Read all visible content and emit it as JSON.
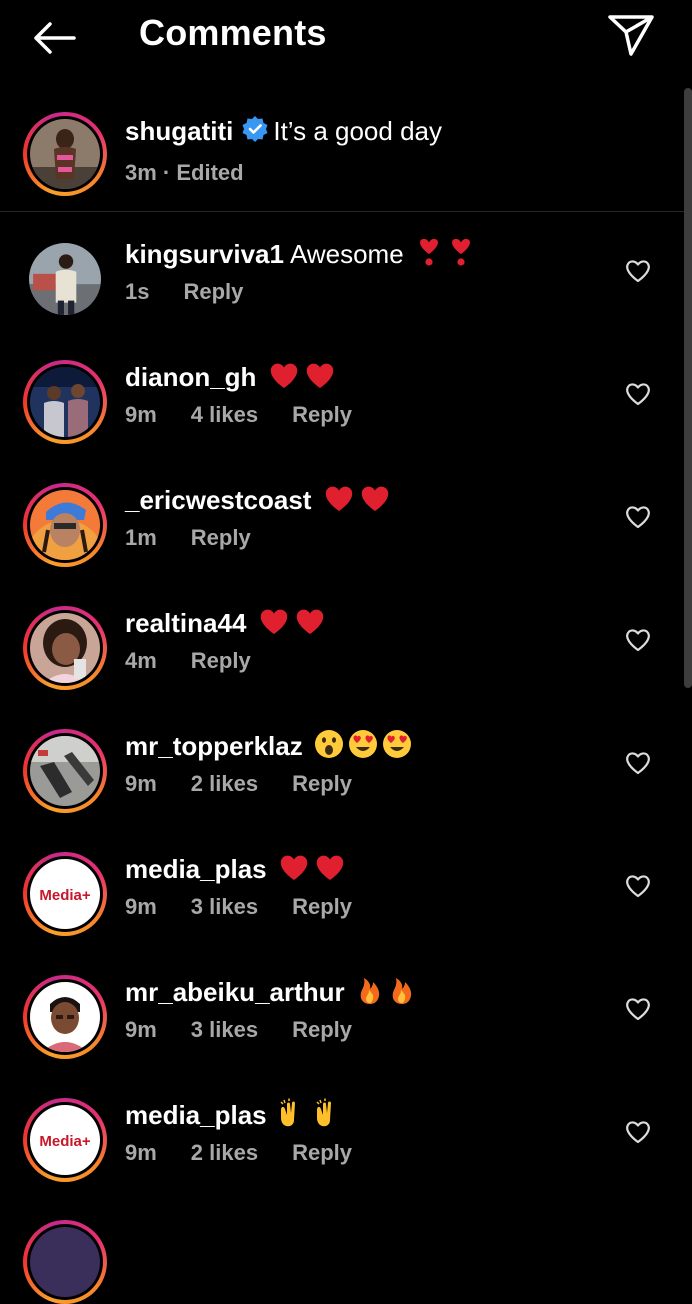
{
  "header": {
    "title": "Comments"
  },
  "caption": {
    "username": "shugatiti",
    "text": "It’s a good day",
    "meta": "3m · Edited"
  },
  "comments": [
    {
      "username": "kingsurviva1",
      "text": "Awesome",
      "emojis": [
        "heavy-heart-exclamation",
        "heavy-heart-exclamation"
      ],
      "time": "1s",
      "likes": "",
      "reply": "Reply"
    },
    {
      "username": "dianon_gh",
      "text": "",
      "emojis": [
        "red-heart",
        "red-heart"
      ],
      "time": "9m",
      "likes": "4 likes",
      "reply": "Reply"
    },
    {
      "username": "_ericwestcoast",
      "text": "",
      "emojis": [
        "red-heart",
        "red-heart"
      ],
      "time": "1m",
      "likes": "",
      "reply": "Reply"
    },
    {
      "username": "realtina44",
      "text": "",
      "emojis": [
        "red-heart",
        "red-heart"
      ],
      "time": "4m",
      "likes": "",
      "reply": "Reply"
    },
    {
      "username": "mr_topperklaz",
      "text": "",
      "emojis": [
        "astonished-face",
        "heart-eyes",
        "heart-eyes"
      ],
      "time": "9m",
      "likes": "2 likes",
      "reply": "Reply"
    },
    {
      "username": "media_plas",
      "text": "",
      "emojis": [
        "red-heart",
        "red-heart"
      ],
      "time": "9m",
      "likes": "3 likes",
      "reply": "Reply"
    },
    {
      "username": "mr_abeiku_arthur",
      "text": "",
      "emojis": [
        "fire",
        "fire"
      ],
      "time": "9m",
      "likes": "3 likes",
      "reply": "Reply"
    },
    {
      "username": "media_plas",
      "text": "",
      "emojis": [
        "raising-hands",
        "raising-hands"
      ],
      "time": "9m",
      "likes": "2 likes",
      "reply": "Reply"
    }
  ],
  "avatars": {
    "media_logo_text": "Media+"
  },
  "colors": {
    "background": "#000000",
    "secondary_text": "#a8a8a8",
    "verified_blue": "#3897f0",
    "heart_red": "#e0245e"
  }
}
